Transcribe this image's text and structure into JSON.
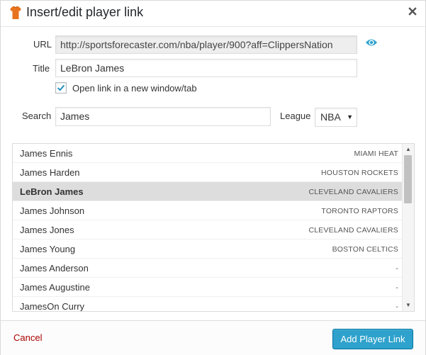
{
  "dialog": {
    "title": "Insert/edit player link",
    "logo_icon": "jersey-icon",
    "close_icon": "close-icon"
  },
  "form": {
    "url_label": "URL",
    "url_value": "http://sportsforecaster.com/nba/player/900?aff=ClippersNation",
    "title_label": "Title",
    "title_value": "LeBron James",
    "new_window_label": "Open link in a new window/tab",
    "new_window_checked": true,
    "search_label": "Search",
    "search_value": "James",
    "league_label": "League",
    "league_value": "NBA"
  },
  "results": [
    {
      "name": "James Ennis",
      "team": "MIAMI HEAT",
      "selected": false
    },
    {
      "name": "James Harden",
      "team": "HOUSTON ROCKETS",
      "selected": false
    },
    {
      "name": "LeBron James",
      "team": "CLEVELAND CAVALIERS",
      "selected": true
    },
    {
      "name": "James Johnson",
      "team": "TORONTO RAPTORS",
      "selected": false
    },
    {
      "name": "James Jones",
      "team": "CLEVELAND CAVALIERS",
      "selected": false
    },
    {
      "name": "James Young",
      "team": "BOSTON CELTICS",
      "selected": false
    },
    {
      "name": "James Anderson",
      "team": "-",
      "selected": false
    },
    {
      "name": "James Augustine",
      "team": "-",
      "selected": false
    },
    {
      "name": "JamesOn Curry",
      "team": "-",
      "selected": false
    }
  ],
  "footer": {
    "cancel_label": "Cancel",
    "submit_label": "Add Player Link"
  },
  "colors": {
    "accent": "#2ea2cc",
    "cancel": "#aa0000",
    "logo": "#e8731e",
    "eye": "#2ea2cc"
  }
}
